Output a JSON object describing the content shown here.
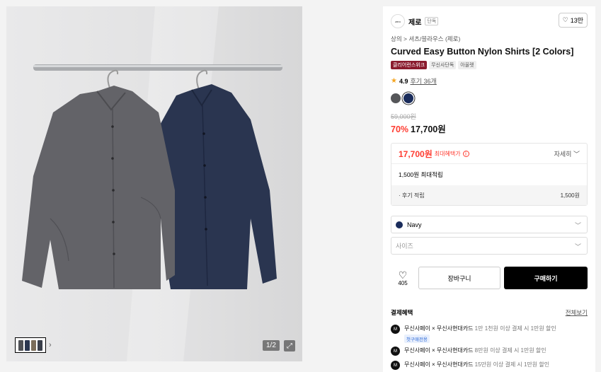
{
  "gallery": {
    "counter": "1/2",
    "thumbnail_colors": [
      "#4f5156",
      "#2a3650",
      "#7b6d5a",
      "#3a3f4a"
    ]
  },
  "brand": {
    "logo_text": "zero",
    "name": "제로",
    "tag": "단독",
    "like_count": "13만"
  },
  "breadcrumb": "상의 > 셔츠/블라우스 (제로)",
  "product": {
    "title": "Curved Easy Button Nylon Shirts [2 Colors]",
    "badges": [
      {
        "label": "클리어런스위크",
        "style": "red"
      },
      {
        "label": "무신사단독",
        "style": "grey"
      },
      {
        "label": "아울렛",
        "style": "grey"
      }
    ],
    "rating": "4.9",
    "reviews": "후기 36개",
    "colors": [
      {
        "name": "gray",
        "hex": "#555659"
      },
      {
        "name": "navy",
        "hex": "#1a2c5b"
      }
    ]
  },
  "price": {
    "original": "59,000원",
    "discount_rate": "70%",
    "sale": "17,700원"
  },
  "benefit": {
    "max_amount": "17,700원",
    "max_label": "최대혜택가",
    "info_icon": "i",
    "detail": "자세히",
    "points": "1,500원 최대적립",
    "review_label": "· 후기 적립",
    "review_value": "1,500원"
  },
  "options": {
    "color_value": "Navy",
    "size_placeholder": "사이즈"
  },
  "actions": {
    "wish_count": "405",
    "cart": "장바구니",
    "buy": "구매하기"
  },
  "payment": {
    "title": "결제혜택",
    "view_all": "전체보기",
    "items": [
      {
        "strong": "무신사페이 × 무신사현대카드",
        "light": "1만 1천원 이상 결제 시 1만원 할인",
        "tag": "첫구매전용"
      },
      {
        "strong": "무신사페이 × 무신사현대카드",
        "light": "8만원 이상 결제 시 1만원 할인",
        "tag": ""
      },
      {
        "strong": "무신사페이 × 무신사현대카드",
        "light": "15만원 이상 결제 시 1만원 할인",
        "tag": ""
      }
    ]
  }
}
